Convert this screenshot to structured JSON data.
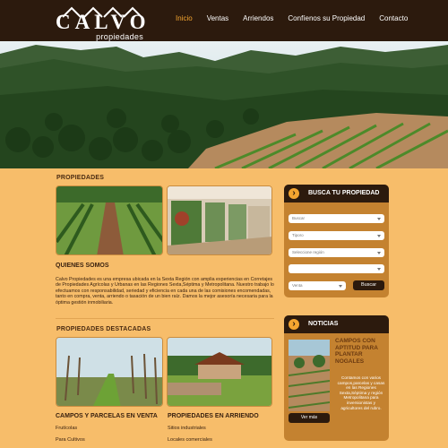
{
  "header": {
    "logo_text": "CALVO",
    "logo_sub": "propiedades",
    "nav": [
      {
        "label": "Inicio",
        "active": true
      },
      {
        "label": "Ventas"
      },
      {
        "label": "Arriendos"
      },
      {
        "label": "Confíenos su Propiedad"
      },
      {
        "label": "Contacto"
      }
    ]
  },
  "main": {
    "propiedades_title": "PROPIEDADES",
    "quienes_title": "QUIENES SOMOS",
    "quienes_text": "Calvo Propiedades es una empresa ubicada en la Sexta Región con amplia experiencias en Corretajes de Propiedades Agrícolas y Urbanas en las Regiones Sexta,Séptima y Metropolitana. Nuestro trabajo lo efectuamos con responsabilidad, seriedad y eficiencia en cada una de las comisiones encomendadas, tanto en compra, venta, arriendo o tasación de un bien raíz. Damos la mejor asesoría necesaria para la óptima gestión inmobiliaria.",
    "destacadas_title": "PROPIEDADES DESTACADAS",
    "campos_caption": "CAMPOS Y PARCELAS EN VENTA",
    "campos_items": [
      "Frutícolas",
      "Para Cultivos"
    ],
    "arriendo_caption": "PROPIEDADES EN ARRIENDO",
    "arriendo_items": [
      "Sitios industriales",
      "Locales comerciales"
    ]
  },
  "search": {
    "title": "BUSCA TU PROPIEDAD",
    "selects": [
      "Buscar",
      "Tiporo",
      "Seleccione región",
      "",
      "Venta"
    ],
    "button": "Buscar"
  },
  "news": {
    "title": "NOTICIAS",
    "headline": "CAMPOS CON APTITUD PARA PLANTAR NOGALES",
    "text": "Contamos con varios campos,parcelas y casas en las Regiones Sexta,Séptima y región Metropolitana para inversionistas y agricultores del rubro.",
    "more": "Ver más"
  },
  "colors": {
    "background": "#f7bd6a",
    "header": "#2c1a0d",
    "accent": "#f4a530",
    "panel": "#c48230"
  }
}
